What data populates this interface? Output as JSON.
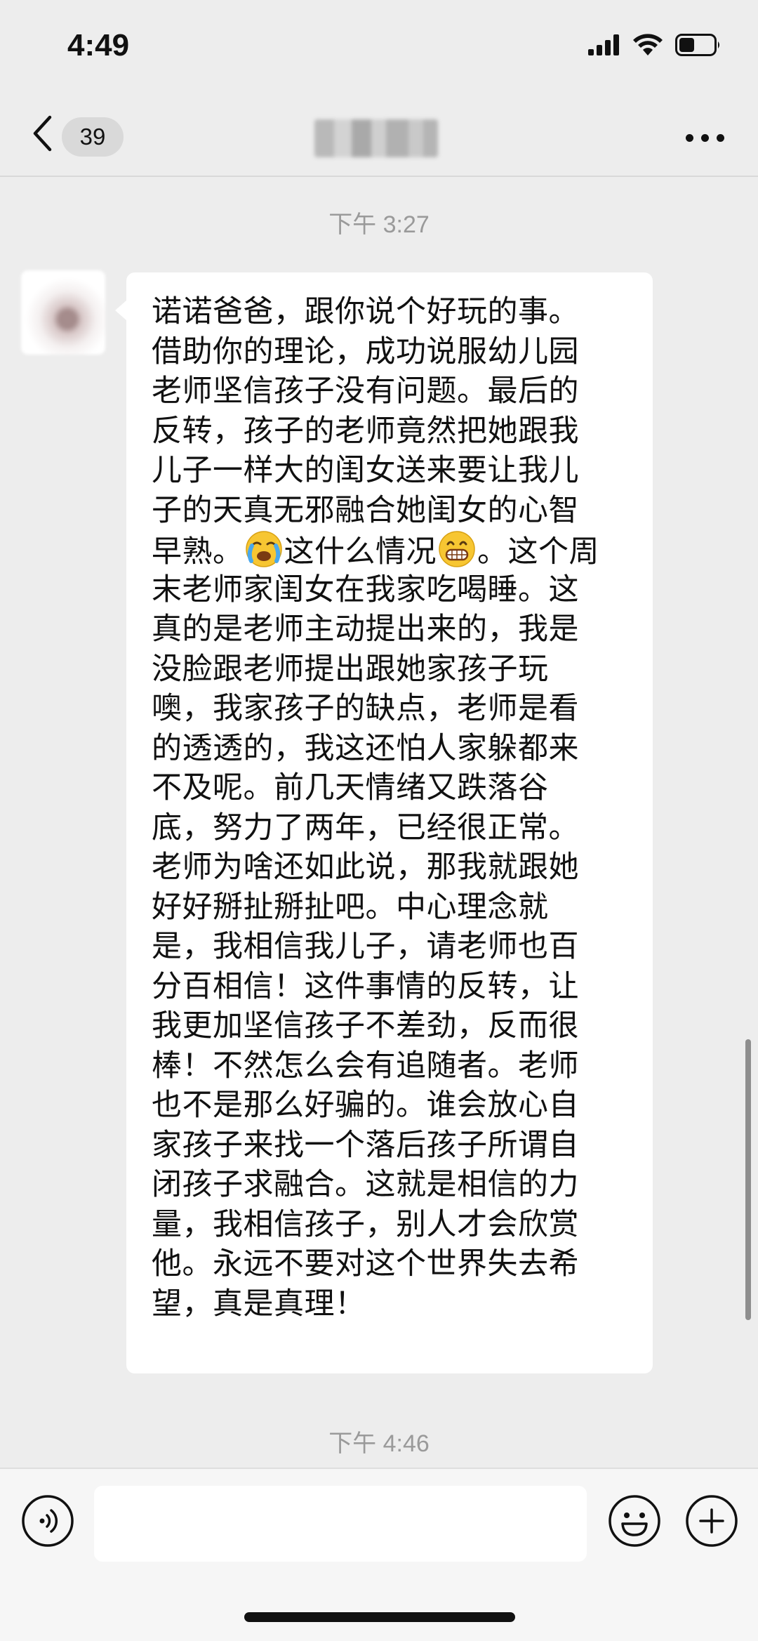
{
  "status_bar": {
    "time": "4:49",
    "icons": [
      "cellular-signal-icon",
      "wifi-icon",
      "battery-icon"
    ],
    "battery_level": 0.45
  },
  "nav_bar": {
    "back_icon": "chevron-left-icon",
    "unread_count": "39",
    "more_icon": "more-dots-icon"
  },
  "timestamps": [
    "下午 3:27",
    "下午 4:46"
  ],
  "message": {
    "lines": [
      "诺诺爸爸，跟你说个好玩的事。",
      "借助你的理论，成功说服幼儿园",
      "老师坚信孩子没有问题。最后的",
      "反转，孩子的老师竟然把她跟我",
      "儿子一样大的闺女送来要让我儿",
      "子的天真无邪融合她闺女的心智",
      "早熟。",
      "末老师家闺女在我家吃喝睡。这",
      "真的是老师主动提出来的，我是",
      "没脸跟老师提出跟她家孩子玩",
      "噢，我家孩子的缺点，老师是看",
      "的透透的，我这还怕人家躲都来",
      "不及呢。前几天情绪又跌落谷",
      "底，努力了两年，已经很正常。",
      "老师为啥还如此说，那我就跟她",
      "好好掰扯掰扯吧。中心理念就",
      "是，我相信我儿子，请老师也百",
      "分百相信！这件事情的反转，让",
      "我更加坚信孩子不差劲，反而很",
      "棒！不然怎么会有追随者。老师",
      "也不是那么好骗的。谁会放心自",
      "家孩子来找一个落后孩子所谓自",
      "闭孩子求融合。这就是相信的力",
      "量，我相信孩子，别人才会欣赏",
      "他。永远不要对这个世界失去希",
      "望，真是真理！"
    ],
    "line7_middle": "这什么情况",
    "line7_end": "。这个周",
    "emoji_1": "crying-face-emoji",
    "emoji_2": "grinning-face-emoji"
  },
  "input_bar": {
    "voice_icon": "voice-icon",
    "emoji_icon": "smiley-icon",
    "plus_icon": "plus-icon",
    "input_value": ""
  }
}
